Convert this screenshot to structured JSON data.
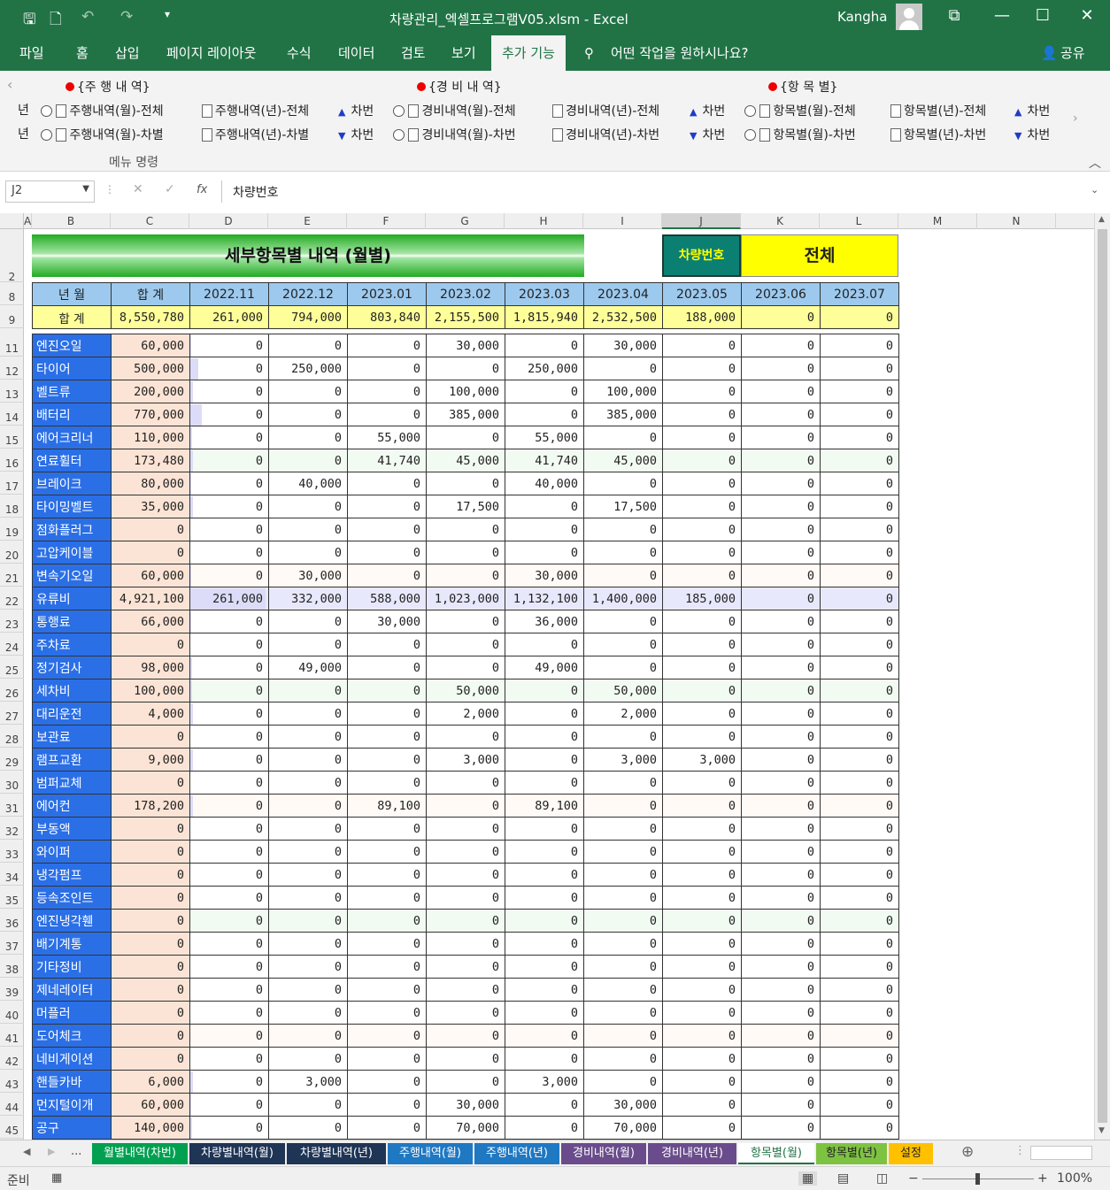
{
  "window": {
    "title": "차량관리_엑셀프로그램V05.xlsm  -  Excel",
    "user": "Kangha",
    "buttons": {
      "restore": "⧉",
      "minimize": "—",
      "maximize": "☐",
      "close": "✕"
    }
  },
  "quick_access": {
    "save": "💾",
    "preview": "🔍",
    "undo": "↶",
    "redo": "↷",
    "customize": "▾"
  },
  "ribbon_tabs": [
    "파일",
    "홈",
    "삽입",
    "페이지 레이아웃",
    "수식",
    "데이터",
    "검토",
    "보기",
    "추가 기능"
  ],
  "tell_me": "어떤 작업을 원하시나요?",
  "share": "공유",
  "ribbon": {
    "group_label": "메뉴 명령",
    "sections": [
      {
        "title": "{주 행 내 역}",
        "row1": [
          "주행내역(월)-전체",
          "주행내역(년)-전체",
          "차번"
        ],
        "row2": [
          "주행내역(월)-차별",
          "주행내역(년)-차별",
          "차번"
        ]
      },
      {
        "title": "{경 비 내 역}",
        "row1": [
          "경비내역(월)-전체",
          "경비내역(년)-전체",
          "차번"
        ],
        "row2": [
          "경비내역(월)-차번",
          "경비내역(년)-차번",
          "차번"
        ]
      },
      {
        "title": "{항 목 별}",
        "row1": [
          "항목별(월)-전체",
          "항목별(년)-전체",
          "차번"
        ],
        "row2": [
          "항목별(월)-차번",
          "항목별(년)-차번",
          "차번"
        ]
      }
    ],
    "left_edge": [
      "년",
      "년"
    ]
  },
  "formula_bar": {
    "name_box": "J2",
    "content": "차량번호",
    "fx": "fx"
  },
  "columns": [
    "A",
    "B",
    "C",
    "D",
    "E",
    "F",
    "G",
    "H",
    "I",
    "J",
    "K",
    "L",
    "M",
    "N"
  ],
  "row_numbers": [
    "2",
    "8",
    "9",
    "11",
    "12",
    "13",
    "14",
    "15",
    "16",
    "17",
    "18",
    "19",
    "20",
    "21",
    "22",
    "23",
    "24",
    "25",
    "26",
    "27",
    "28",
    "29",
    "30",
    "31",
    "32",
    "33",
    "34",
    "35",
    "36",
    "37",
    "38",
    "39",
    "40",
    "41",
    "42",
    "43",
    "44",
    "45"
  ],
  "sheet": {
    "title": "세부항목별 내역 (월별)",
    "vehicle_label": "차량번호",
    "vehicle_value": "전체",
    "header": [
      "년  월",
      "합  계",
      "2022.11",
      "2022.12",
      "2023.01",
      "2023.02",
      "2023.03",
      "2023.04",
      "2023.05",
      "2023.06",
      "2023.07"
    ],
    "sum_row": [
      "합  계",
      "8,550,780",
      "261,000",
      "794,000",
      "803,840",
      "2,155,500",
      "1,815,940",
      "2,532,500",
      "188,000",
      "0",
      "0"
    ],
    "rows": [
      {
        "item": "엔진오일",
        "total": "60,000",
        "bar": 0.012,
        "m": [
          "0",
          "0",
          "0",
          "30,000",
          "0",
          "30,000",
          "0",
          "0",
          "0"
        ]
      },
      {
        "item": "타이어",
        "total": "500,000",
        "bar": 0.102,
        "m": [
          "0",
          "250,000",
          "0",
          "0",
          "250,000",
          "0",
          "0",
          "0",
          "0"
        ]
      },
      {
        "item": "벨트류",
        "total": "200,000",
        "bar": 0.041,
        "m": [
          "0",
          "0",
          "0",
          "100,000",
          "0",
          "100,000",
          "0",
          "0",
          "0"
        ]
      },
      {
        "item": "배터리",
        "total": "770,000",
        "bar": 0.156,
        "m": [
          "0",
          "0",
          "0",
          "385,000",
          "0",
          "385,000",
          "0",
          "0",
          "0"
        ]
      },
      {
        "item": "에어크리너",
        "total": "110,000",
        "bar": 0.022,
        "m": [
          "0",
          "0",
          "55,000",
          "0",
          "55,000",
          "0",
          "0",
          "0",
          "0"
        ]
      },
      {
        "item": "연료휠터",
        "total": "173,480",
        "bar": 0.035,
        "m": [
          "0",
          "0",
          "41,740",
          "45,000",
          "41,740",
          "45,000",
          "0",
          "0",
          "0"
        ]
      },
      {
        "item": "브레이크",
        "total": "80,000",
        "bar": 0.016,
        "m": [
          "0",
          "40,000",
          "0",
          "0",
          "40,000",
          "0",
          "0",
          "0",
          "0"
        ]
      },
      {
        "item": "타이밍벨트",
        "total": "35,000",
        "bar": 0.007,
        "m": [
          "0",
          "0",
          "0",
          "17,500",
          "0",
          "17,500",
          "0",
          "0",
          "0"
        ]
      },
      {
        "item": "점화플러그",
        "total": "0",
        "bar": 0,
        "m": [
          "0",
          "0",
          "0",
          "0",
          "0",
          "0",
          "0",
          "0",
          "0"
        ]
      },
      {
        "item": "고압케이블",
        "total": "0",
        "bar": 0,
        "m": [
          "0",
          "0",
          "0",
          "0",
          "0",
          "0",
          "0",
          "0",
          "0"
        ]
      },
      {
        "item": "변속기오일",
        "total": "60,000",
        "bar": 0.012,
        "m": [
          "0",
          "30,000",
          "0",
          "0",
          "30,000",
          "0",
          "0",
          "0",
          "0"
        ]
      },
      {
        "item": "유류비",
        "total": "4,921,100",
        "bar": 1,
        "m": [
          "261,000",
          "332,000",
          "588,000",
          "1,023,000",
          "1,132,100",
          "1,400,000",
          "185,000",
          "0",
          "0"
        ]
      },
      {
        "item": "통행료",
        "total": "66,000",
        "bar": 0.013,
        "m": [
          "0",
          "0",
          "30,000",
          "0",
          "36,000",
          "0",
          "0",
          "0",
          "0"
        ]
      },
      {
        "item": "주차료",
        "total": "0",
        "bar": 0,
        "m": [
          "0",
          "0",
          "0",
          "0",
          "0",
          "0",
          "0",
          "0",
          "0"
        ]
      },
      {
        "item": "정기검사",
        "total": "98,000",
        "bar": 0.02,
        "m": [
          "0",
          "49,000",
          "0",
          "0",
          "49,000",
          "0",
          "0",
          "0",
          "0"
        ]
      },
      {
        "item": "세차비",
        "total": "100,000",
        "bar": 0.02,
        "m": [
          "0",
          "0",
          "0",
          "50,000",
          "0",
          "50,000",
          "0",
          "0",
          "0"
        ]
      },
      {
        "item": "대리운전",
        "total": "4,000",
        "bar": 0.001,
        "m": [
          "0",
          "0",
          "0",
          "2,000",
          "0",
          "2,000",
          "0",
          "0",
          "0"
        ]
      },
      {
        "item": "보관료",
        "total": "0",
        "bar": 0,
        "m": [
          "0",
          "0",
          "0",
          "0",
          "0",
          "0",
          "0",
          "0",
          "0"
        ]
      },
      {
        "item": "램프교환",
        "total": "9,000",
        "bar": 0.002,
        "m": [
          "0",
          "0",
          "0",
          "3,000",
          "0",
          "3,000",
          "3,000",
          "0",
          "0"
        ]
      },
      {
        "item": "범퍼교체",
        "total": "0",
        "bar": 0,
        "m": [
          "0",
          "0",
          "0",
          "0",
          "0",
          "0",
          "0",
          "0",
          "0"
        ]
      },
      {
        "item": "에어컨",
        "total": "178,200",
        "bar": 0.036,
        "m": [
          "0",
          "0",
          "89,100",
          "0",
          "89,100",
          "0",
          "0",
          "0",
          "0"
        ]
      },
      {
        "item": "부동액",
        "total": "0",
        "bar": 0,
        "m": [
          "0",
          "0",
          "0",
          "0",
          "0",
          "0",
          "0",
          "0",
          "0"
        ]
      },
      {
        "item": "와이퍼",
        "total": "0",
        "bar": 0,
        "m": [
          "0",
          "0",
          "0",
          "0",
          "0",
          "0",
          "0",
          "0",
          "0"
        ]
      },
      {
        "item": "냉각펌프",
        "total": "0",
        "bar": 0,
        "m": [
          "0",
          "0",
          "0",
          "0",
          "0",
          "0",
          "0",
          "0",
          "0"
        ]
      },
      {
        "item": "등속조인트",
        "total": "0",
        "bar": 0,
        "m": [
          "0",
          "0",
          "0",
          "0",
          "0",
          "0",
          "0",
          "0",
          "0"
        ]
      },
      {
        "item": "엔진냉각휀",
        "total": "0",
        "bar": 0,
        "m": [
          "0",
          "0",
          "0",
          "0",
          "0",
          "0",
          "0",
          "0",
          "0"
        ]
      },
      {
        "item": "배기계통",
        "total": "0",
        "bar": 0,
        "m": [
          "0",
          "0",
          "0",
          "0",
          "0",
          "0",
          "0",
          "0",
          "0"
        ]
      },
      {
        "item": "기타정비",
        "total": "0",
        "bar": 0,
        "m": [
          "0",
          "0",
          "0",
          "0",
          "0",
          "0",
          "0",
          "0",
          "0"
        ]
      },
      {
        "item": "제네레이터",
        "total": "0",
        "bar": 0,
        "m": [
          "0",
          "0",
          "0",
          "0",
          "0",
          "0",
          "0",
          "0",
          "0"
        ]
      },
      {
        "item": "머플러",
        "total": "0",
        "bar": 0,
        "m": [
          "0",
          "0",
          "0",
          "0",
          "0",
          "0",
          "0",
          "0",
          "0"
        ]
      },
      {
        "item": "도어체크",
        "total": "0",
        "bar": 0,
        "m": [
          "0",
          "0",
          "0",
          "0",
          "0",
          "0",
          "0",
          "0",
          "0"
        ]
      },
      {
        "item": "네비게이션",
        "total": "0",
        "bar": 0,
        "m": [
          "0",
          "0",
          "0",
          "0",
          "0",
          "0",
          "0",
          "0",
          "0"
        ]
      },
      {
        "item": "핸들카바",
        "total": "6,000",
        "bar": 0.001,
        "m": [
          "0",
          "3,000",
          "0",
          "0",
          "3,000",
          "0",
          "0",
          "0",
          "0"
        ]
      },
      {
        "item": "먼지털이개",
        "total": "60,000",
        "bar": 0.012,
        "m": [
          "0",
          "0",
          "0",
          "30,000",
          "0",
          "30,000",
          "0",
          "0",
          "0"
        ]
      },
      {
        "item": "공구",
        "total": "140,000",
        "bar": 0.028,
        "m": [
          "0",
          "0",
          "0",
          "70,000",
          "0",
          "70,000",
          "0",
          "0",
          "0"
        ]
      }
    ]
  },
  "sheet_tabs": [
    {
      "label": "월별내역(차번)",
      "color": "#00a050"
    },
    {
      "label": "차량별내역(월)",
      "color": "#1f3556"
    },
    {
      "label": "차량별내역(년)",
      "color": "#1f3556"
    },
    {
      "label": "주행내역(월)",
      "color": "#1f78c2"
    },
    {
      "label": "주행내역(년)",
      "color": "#1f78c2"
    },
    {
      "label": "경비내역(월)",
      "color": "#6a4c8c"
    },
    {
      "label": "경비내역(년)",
      "color": "#6a4c8c"
    },
    {
      "label": "항목별(월)",
      "color": "#ffffff"
    },
    {
      "label": "항목별(년)",
      "color": "#7ec242"
    },
    {
      "label": "설정",
      "color": "#ffc000"
    }
  ],
  "sheet_nav": {
    "ellipsis": "..."
  },
  "status": {
    "ready": "준비",
    "zoom": "100%"
  }
}
